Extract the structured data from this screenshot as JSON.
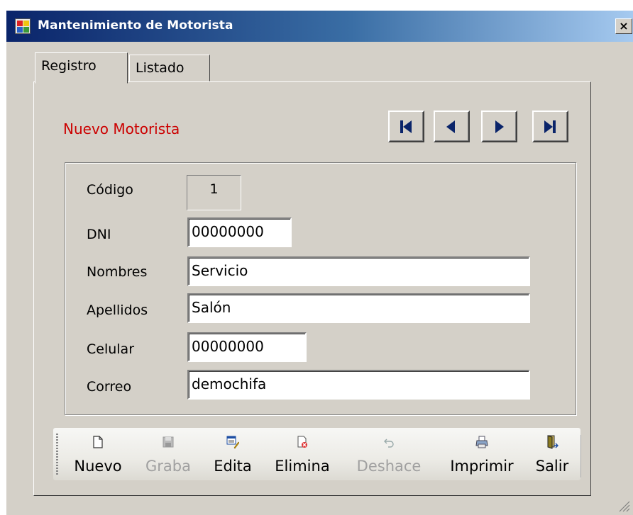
{
  "window": {
    "title": "Mantenimiento de Motorista",
    "close_label": "×"
  },
  "tabs": [
    {
      "label": "Registro",
      "active": true
    },
    {
      "label": "Listado",
      "active": false
    }
  ],
  "form": {
    "title": "Nuevo Motorista",
    "nav_buttons": [
      "first",
      "previous",
      "next",
      "last"
    ],
    "fields": {
      "codigo": {
        "label": "Código",
        "value": "1"
      },
      "dni": {
        "label": "DNI",
        "value": "00000000"
      },
      "nombres": {
        "label": "Nombres",
        "value": "Servicio"
      },
      "apellidos": {
        "label": "Apellidos",
        "value": "Salón"
      },
      "celular": {
        "label": "Celular",
        "value": "00000000"
      },
      "correo": {
        "label": "Correo",
        "value": "demochifa"
      }
    }
  },
  "toolbar": {
    "nuevo": "Nuevo",
    "graba": "Graba",
    "edita": "Edita",
    "elimina": "Elimina",
    "deshace": "Deshace",
    "imprimir": "Imprimir",
    "salir": "Salir"
  },
  "colors": {
    "title_red": "#cc0000",
    "nav_arrow": "#0a246a",
    "window_bg": "#d4d0c8"
  }
}
